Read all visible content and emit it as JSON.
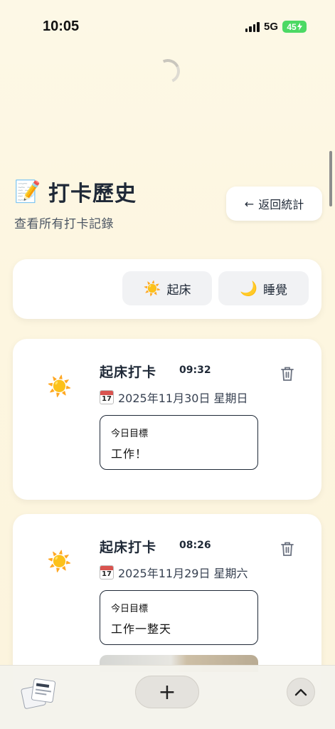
{
  "status_bar": {
    "time": "10:05",
    "network": "5G",
    "battery": "45"
  },
  "header": {
    "title_icon": "📝",
    "title": "打卡歷史",
    "subtitle": "查看所有打卡記錄",
    "back_button": "返回統計",
    "back_icon": "←"
  },
  "filters": [
    {
      "icon": "☀️",
      "label": "起床"
    },
    {
      "icon": "🌙",
      "label": "睡覺"
    }
  ],
  "entries": [
    {
      "icon": "☀️",
      "type": "起床打卡",
      "time": "09:32",
      "date": "2025年11月30日 星期日",
      "calendar_day": "17",
      "goal_label": "今日目標",
      "goal_text": "工作！"
    },
    {
      "icon": "☀️",
      "type": "起床打卡",
      "time": "08:26",
      "date": "2025年11月29日 星期六",
      "calendar_day": "17",
      "goal_label": "今日目標",
      "goal_text": "工作一整天"
    }
  ],
  "bottom_bar": {
    "add_icon": "+"
  }
}
